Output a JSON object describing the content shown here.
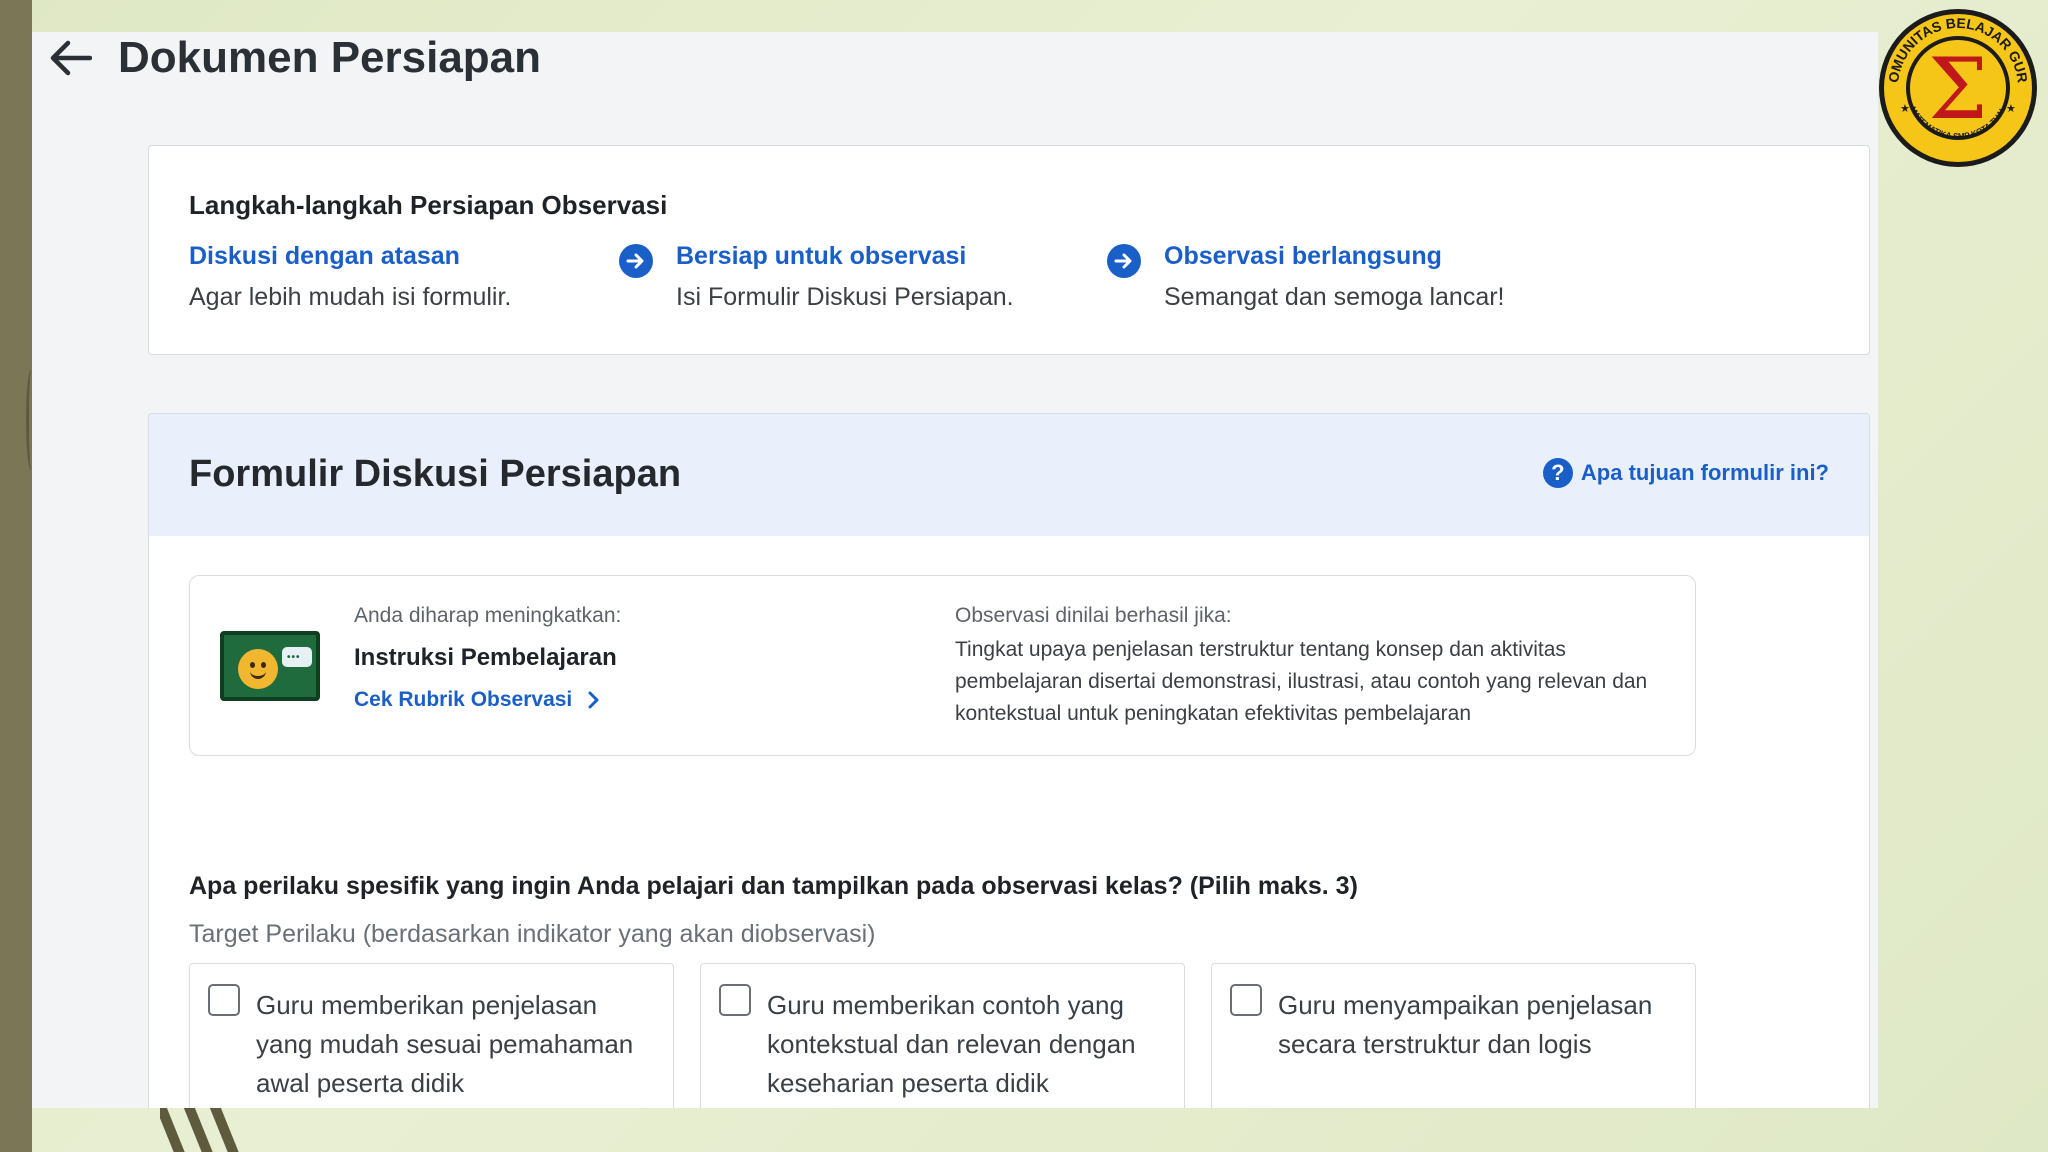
{
  "header": {
    "title": "Dokumen Persiapan",
    "back_icon": "arrow-left-icon"
  },
  "steps_card": {
    "title": "Langkah-langkah Persiapan Observasi",
    "steps": [
      {
        "label": "Diskusi dengan atasan",
        "desc": "Agar lebih mudah isi formulir."
      },
      {
        "label": "Bersiap untuk observasi",
        "desc": "Isi Formulir Diskusi Persiapan."
      },
      {
        "label": "Observasi berlangsung",
        "desc": "Semangat dan semoga lancar!"
      }
    ]
  },
  "form": {
    "title": "Formulir Diskusi Persiapan",
    "help_link": "Apa tujuan formulir ini?",
    "info": {
      "improve_label": "Anda diharap meningkatkan:",
      "improve_value": "Instruksi Pembelajaran",
      "rubric_link": "Cek Rubrik Observasi",
      "success_label": "Observasi dinilai berhasil jika:",
      "success_text": "Tingkat upaya penjelasan terstruktur tentang konsep dan aktivitas pembelajaran disertai demonstrasi, ilustrasi, atau contoh yang relevan dan kontekstual untuk peningkatan efektivitas pembelajaran"
    },
    "question": "Apa perilaku spesifik yang ingin Anda pelajari dan tampilkan pada observasi kelas? (Pilih maks. 3)",
    "target_label": "Target Perilaku (berdasarkan indikator yang akan diobservasi)",
    "options": [
      {
        "text": "Guru memberikan penjelasan yang mudah sesuai pemahaman awal peserta didik",
        "checked": false
      },
      {
        "text": "Guru memberikan contoh yang kontekstual  dan relevan dengan keseharian peserta didik",
        "checked": false
      },
      {
        "text": "Guru menyampaikan penjelasan secara terstruktur dan logis",
        "checked": false
      }
    ]
  },
  "logo": {
    "symbol": "Σ",
    "ring_text_top": "KOMUNITAS BELAJAR GURU",
    "ring_text_bottom": "MATEMATIKA SMP KOTA TUAL"
  },
  "colors": {
    "accent": "#1a5fc8",
    "header_band": "#e9f0fb",
    "background": "#e3ebc9",
    "left_bar": "#7a7656",
    "logo_red": "#c0171b",
    "logo_yellow": "#f5c518"
  }
}
